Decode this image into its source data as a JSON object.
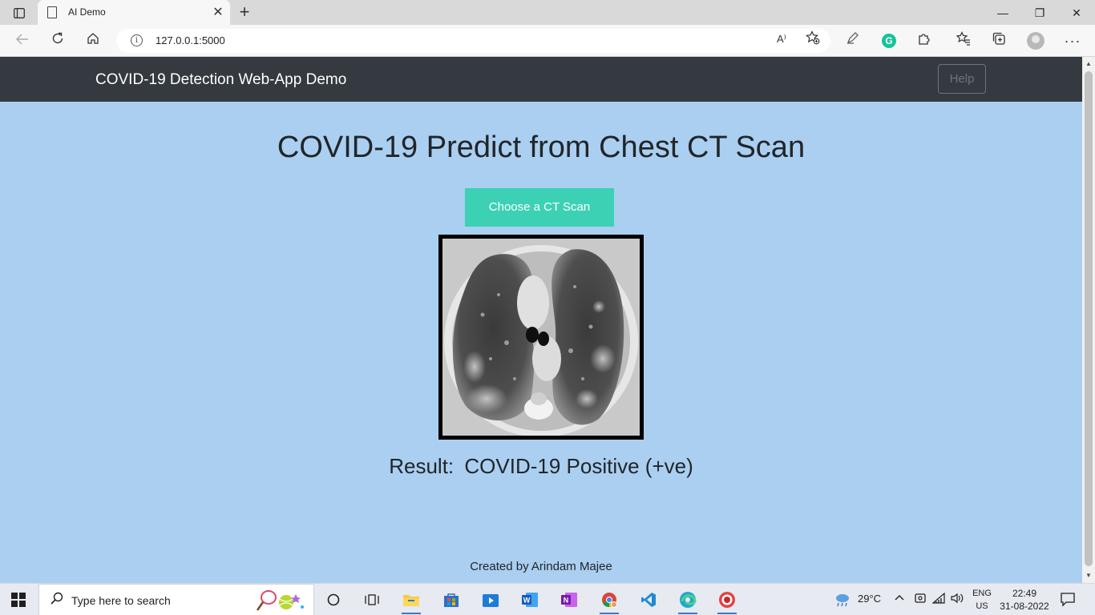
{
  "browser": {
    "tab_title": "AI Demo",
    "tab_close": "✕",
    "new_tab": "+",
    "url": "127.0.0.1:5000",
    "read_aloud": "A⁾",
    "win_minimize": "—",
    "win_restore": "❐",
    "win_close": "✕",
    "icons": [
      "tab-actions-icon",
      "back-icon",
      "refresh-icon",
      "home-icon",
      "info-icon",
      "read-aloud-icon",
      "add-favorite-icon",
      "pen-icon",
      "grammarly-icon",
      "extensions-icon",
      "favorites-icon",
      "collections-icon",
      "profile-icon",
      "more-icon"
    ]
  },
  "navbar": {
    "brand": "COVID-19 Detection Web-App Demo",
    "help_label": "Help",
    "bg_color": "#343a40"
  },
  "main": {
    "heading": "COVID-19 Predict from Chest CT Scan",
    "choose_button": "Choose a CT Scan",
    "choose_color": "#3cd1b4",
    "result_label": "Result:",
    "result_value": "COVID-19 Positive (+ve)",
    "footer": "Created by Arindam Majee",
    "bg_color": "#aacff0"
  },
  "taskbar": {
    "search_placeholder": "Type here to search",
    "weather": "29°C",
    "lang_line1": "ENG",
    "lang_line2": "US",
    "time": "22:49",
    "date": "31-08-2022",
    "pinned_apps": [
      "task-view",
      "widgets",
      "file-explorer",
      "microsoft-store",
      "media-player",
      "word",
      "onenote",
      "chrome",
      "vscode",
      "edge",
      "recorder"
    ]
  }
}
